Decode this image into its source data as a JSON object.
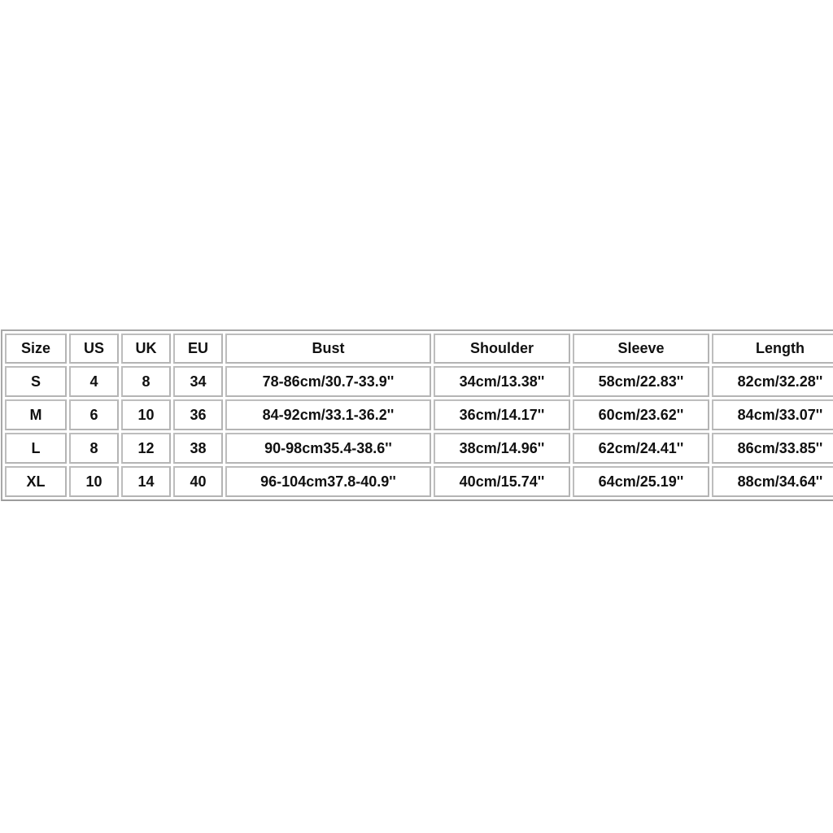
{
  "size_chart": {
    "columns": [
      "Size",
      "US",
      "UK",
      "EU",
      "Bust",
      "Shoulder",
      "Sleeve",
      "Length"
    ],
    "rows": [
      [
        "S",
        "4",
        "8",
        "34",
        "78-86cm/30.7-33.9''",
        "34cm/13.38''",
        "58cm/22.83''",
        "82cm/32.28''"
      ],
      [
        "M",
        "6",
        "10",
        "36",
        "84-92cm/33.1-36.2''",
        "36cm/14.17''",
        "60cm/23.62''",
        "84cm/33.07''"
      ],
      [
        "L",
        "8",
        "12",
        "38",
        "90-98cm35.4-38.6''",
        "38cm/14.96''",
        "62cm/24.41''",
        "86cm/33.85''"
      ],
      [
        "XL",
        "10",
        "14",
        "40",
        "96-104cm37.8-40.9''",
        "40cm/15.74''",
        "64cm/25.19''",
        "88cm/34.64''"
      ]
    ]
  }
}
